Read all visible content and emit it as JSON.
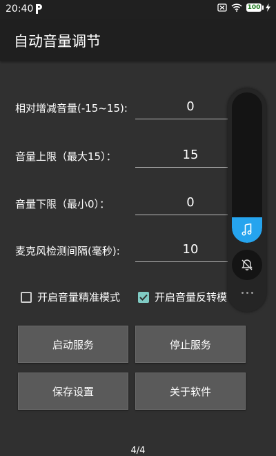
{
  "status_bar": {
    "time": "20:40",
    "battery": "100"
  },
  "appbar": {
    "title": "自动音量调节"
  },
  "form": {
    "rows": [
      {
        "label": "相对增减音量(-15~15):",
        "value": "0"
      },
      {
        "label": "音量上限（最大15）：",
        "value": "15"
      },
      {
        "label": "音量下限（最小0）：",
        "value": "0"
      },
      {
        "label": "麦克风检测间隔(毫秒):",
        "value": "10"
      }
    ]
  },
  "checkboxes": [
    {
      "label": "开启音量精准模式",
      "checked": false
    },
    {
      "label": "开启音量反转模",
      "checked": true
    }
  ],
  "buttons": {
    "start": "启动服务",
    "stop": "停止服务",
    "save": "保存设置",
    "about": "关于软件"
  },
  "page_indicator": "4/4",
  "volume_overlay": {
    "level_fraction": 0.17,
    "fill_color": "#26a4ee",
    "icons": [
      "music-note-icon",
      "bell-off-icon",
      "more-dots-icon"
    ]
  }
}
